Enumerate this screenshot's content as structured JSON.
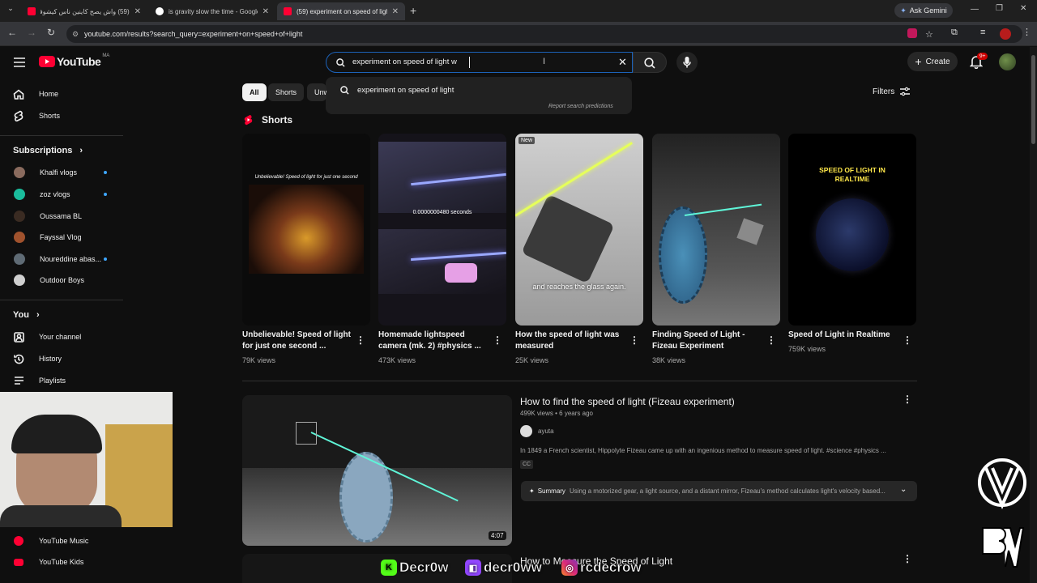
{
  "browser": {
    "tabs": [
      {
        "title": "(59) واش يصح كاينين ناس كيشوفو",
        "color": "#ff0033"
      },
      {
        "title": "is gravity slow the time - Google",
        "color": "#4285f4"
      },
      {
        "title": "(59) experiment on speed of light",
        "color": "#ff0033"
      }
    ],
    "ask_gemini": "Ask Gemini",
    "url": "youtube.com/results?search_query=experiment+on+speed+of+light"
  },
  "header": {
    "logo_text": "YouTube",
    "logo_region": "MA",
    "search_value": "experiment on speed of light w",
    "create_label": "Create",
    "notif_badge": "9+"
  },
  "suggestions": {
    "items": [
      "experiment on speed of light"
    ],
    "report": "Report search predictions"
  },
  "sidebar": {
    "home": "Home",
    "shorts": "Shorts",
    "subscriptions_title": "Subscriptions",
    "subscriptions": [
      {
        "name": "Khalfi vlogs",
        "dot": true,
        "color": "#8a6b5e"
      },
      {
        "name": "zoz vlogs",
        "dot": true,
        "color": "#1abc9c"
      },
      {
        "name": "Oussama BL",
        "dot": false,
        "color": "#3a2b22"
      },
      {
        "name": "Fayssal Vlog",
        "dot": false,
        "color": "#a0522d"
      },
      {
        "name": "Noureddine abas...",
        "dot": true,
        "color": "#5f6b75"
      },
      {
        "name": "Outdoor Boys",
        "dot": false,
        "color": "#cfcfcf"
      }
    ],
    "you_title": "You",
    "your_channel": "Your channel",
    "history": "History",
    "playlists": "Playlists",
    "music": "YouTube Music",
    "kids": "YouTube Kids"
  },
  "chips": [
    "All",
    "Shorts",
    "Unw"
  ],
  "filters_label": "Filters",
  "shorts_section": {
    "title": "Shorts",
    "items": [
      {
        "title": "Unbelievable! Speed of light for just one second ...",
        "views": "79K views",
        "overlay": "Unbelievable! Speed of light for just one second"
      },
      {
        "title": "Homemade lightspeed camera (mk. 2) #physics ...",
        "views": "473K views",
        "overlay": "0.0000000480 seconds"
      },
      {
        "title": "How the speed of light was measured",
        "views": "25K views",
        "overlay": "and reaches the glass again.",
        "badge": "New"
      },
      {
        "title": "Finding Speed of Light - Fizeau Experiment",
        "views": "38K views"
      },
      {
        "title": "Speed of Light in Realtime",
        "views": "759K views",
        "overlay": "SPEED OF LIGHT IN REALTIME"
      }
    ]
  },
  "video": {
    "title": "How to find the speed of light (Fizeau experiment)",
    "views": "499K views",
    "age": "6 years ago",
    "channel": "ayuta",
    "description": "In 1849 a French scientist, Hippolyte Fizeau came up with an ingenious method to measure speed of light. #science #physics ...",
    "cc": "CC",
    "duration": "4:07",
    "summary_label": "Summary",
    "summary_text": "Using a motorized gear, a light source, and a distant mirror, Fizeau's method calculates light's velocity based..."
  },
  "video2": {
    "title": "How to Measure the Speed of Light"
  },
  "overlay": {
    "kick": "Decr0w",
    "twitch": "decr0ww",
    "instagram": "rcdecrow"
  }
}
